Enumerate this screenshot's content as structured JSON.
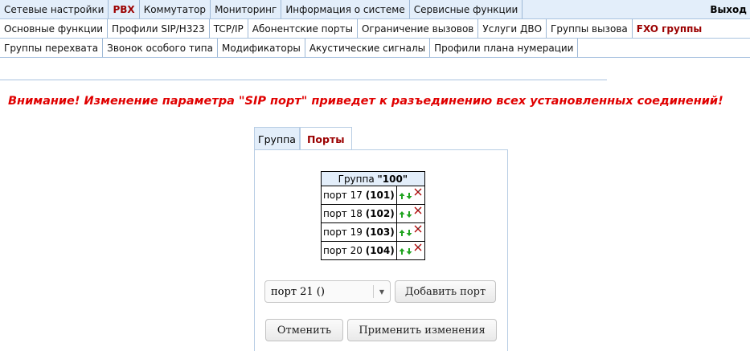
{
  "top_nav": {
    "items": [
      "Сетевые настройки",
      "PBX",
      "Коммутатор",
      "Мониторинг",
      "Информация о системе",
      "Сервисные функции"
    ],
    "exit_label": "Выход"
  },
  "sub_nav_1": {
    "items": [
      "Основные функции",
      "Профили SIP/H323",
      "TCP/IP",
      "Абонентские порты",
      "Ограничение вызовов",
      "Услуги ДВО",
      "Группы вызова",
      "FXO группы"
    ]
  },
  "sub_nav_2": {
    "items": [
      "Группы перехвата",
      "Звонок особого типа",
      "Модификаторы",
      "Акустические сигналы",
      "Профили плана нумерации"
    ]
  },
  "warning_text": "Внимание! Изменение параметра \"SIP порт\" приведет к разъединению всех установленных соединений!",
  "panel_tabs": [
    "Группа",
    "Порты"
  ],
  "group_table": {
    "header_prefix": "Группа ",
    "header_value": "\"100\"",
    "rows": [
      {
        "port_label": "порт 17 ",
        "number": "(101)"
      },
      {
        "port_label": "порт 18 ",
        "number": "(102)"
      },
      {
        "port_label": "порт 19 ",
        "number": "(103)"
      },
      {
        "port_label": "порт 20 ",
        "number": "(104)"
      }
    ]
  },
  "port_select": {
    "value": "порт 21 ()"
  },
  "buttons": {
    "add_port": "Добавить порт",
    "cancel": "Отменить",
    "apply": "Применить изменения"
  },
  "colors": {
    "active_tab": "#9b0000",
    "warning": "#e00000",
    "nav_bg": "#e3eefa",
    "arrow": "#1fa31f",
    "delete_icon": "#b00000"
  }
}
